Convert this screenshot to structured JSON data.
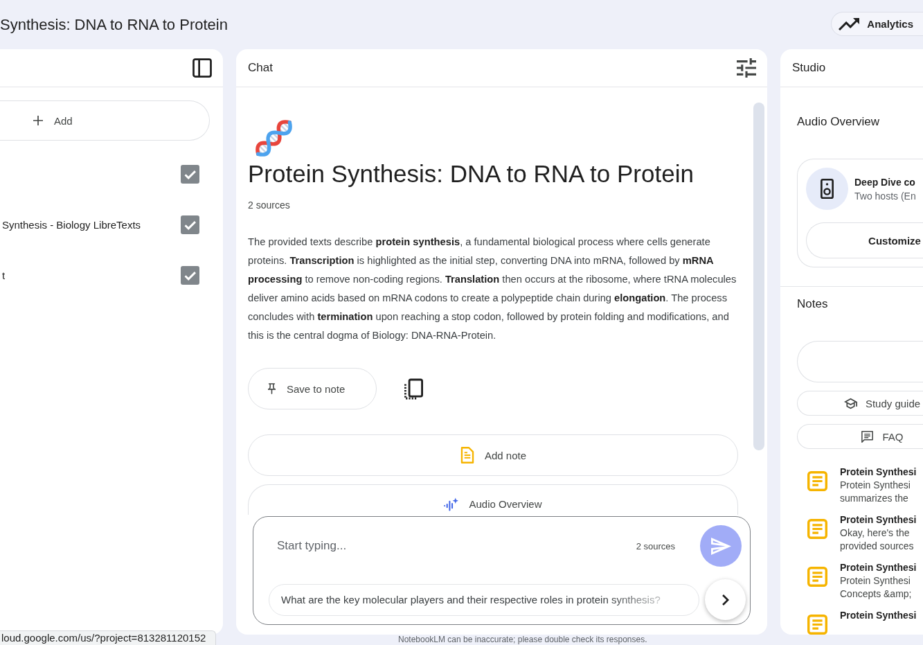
{
  "header": {
    "title": "Synthesis: DNA to RNA to Protein",
    "analytics_button": "Analytics"
  },
  "sources": {
    "add_button": "Add",
    "items": [
      {
        "checked": true
      },
      {
        "title": "Synthesis - Biology LibreTexts",
        "checked": true
      },
      {
        "title": "t",
        "checked": true
      }
    ]
  },
  "chat": {
    "title": "Chat",
    "notebook": {
      "title": "Protein Synthesis: DNA to RNA to Protein",
      "source_count": "2 sources",
      "summary": "The provided texts describe **protein synthesis**, a fundamental biological process where cells generate proteins. **Transcription** is highlighted as the initial step, converting DNA into mRNA, followed by **mRNA processing** to remove non-coding regions. **Translation** then occurs at the ribosome, where tRNA molecules deliver amino acids based on mRNA codons to create a polypeptide chain during **elongation**. The process concludes with **termination** upon reaching a stop codon, followed by protein folding and modifications, and this is the central dogma of Biology: DNA-RNA-Protein."
    },
    "save_button": "Save to note",
    "actions": [
      {
        "kind": "note",
        "label": "Add note"
      },
      {
        "kind": "audio",
        "label": "Audio Overview"
      }
    ],
    "composer": {
      "placeholder": "Start typing...",
      "source_count": "2 sources",
      "suggestion": "What are the key molecular players and their respective roles in protein synthesis?"
    },
    "disclaimer": "NotebookLM can be inaccurate; please double check its responses."
  },
  "studio": {
    "title": "Studio",
    "audio_overview": {
      "heading": "Audio Overview",
      "title": "Deep Dive co",
      "subtitle": "Two hosts (En",
      "customize_button": "Customize"
    },
    "notes": {
      "heading": "Notes",
      "chips": [
        {
          "kind": "study_guide",
          "label": "Study guide"
        },
        {
          "kind": "faq",
          "label": "FAQ"
        }
      ],
      "items": [
        {
          "title": "Protein Synthesi",
          "preview": "Protein Synthesi\nsummarizes the"
        },
        {
          "title": "Protein Synthesi",
          "preview": "Okay, here's the\nprovided sources"
        },
        {
          "title": "Protein Synthesi",
          "preview": "Protein Synthesi\nConcepts &amp;"
        },
        {
          "title": "Protein Synthesi"
        }
      ]
    }
  },
  "status_bar": {
    "url": "loud.google.com/us/?project=813281120152"
  }
}
